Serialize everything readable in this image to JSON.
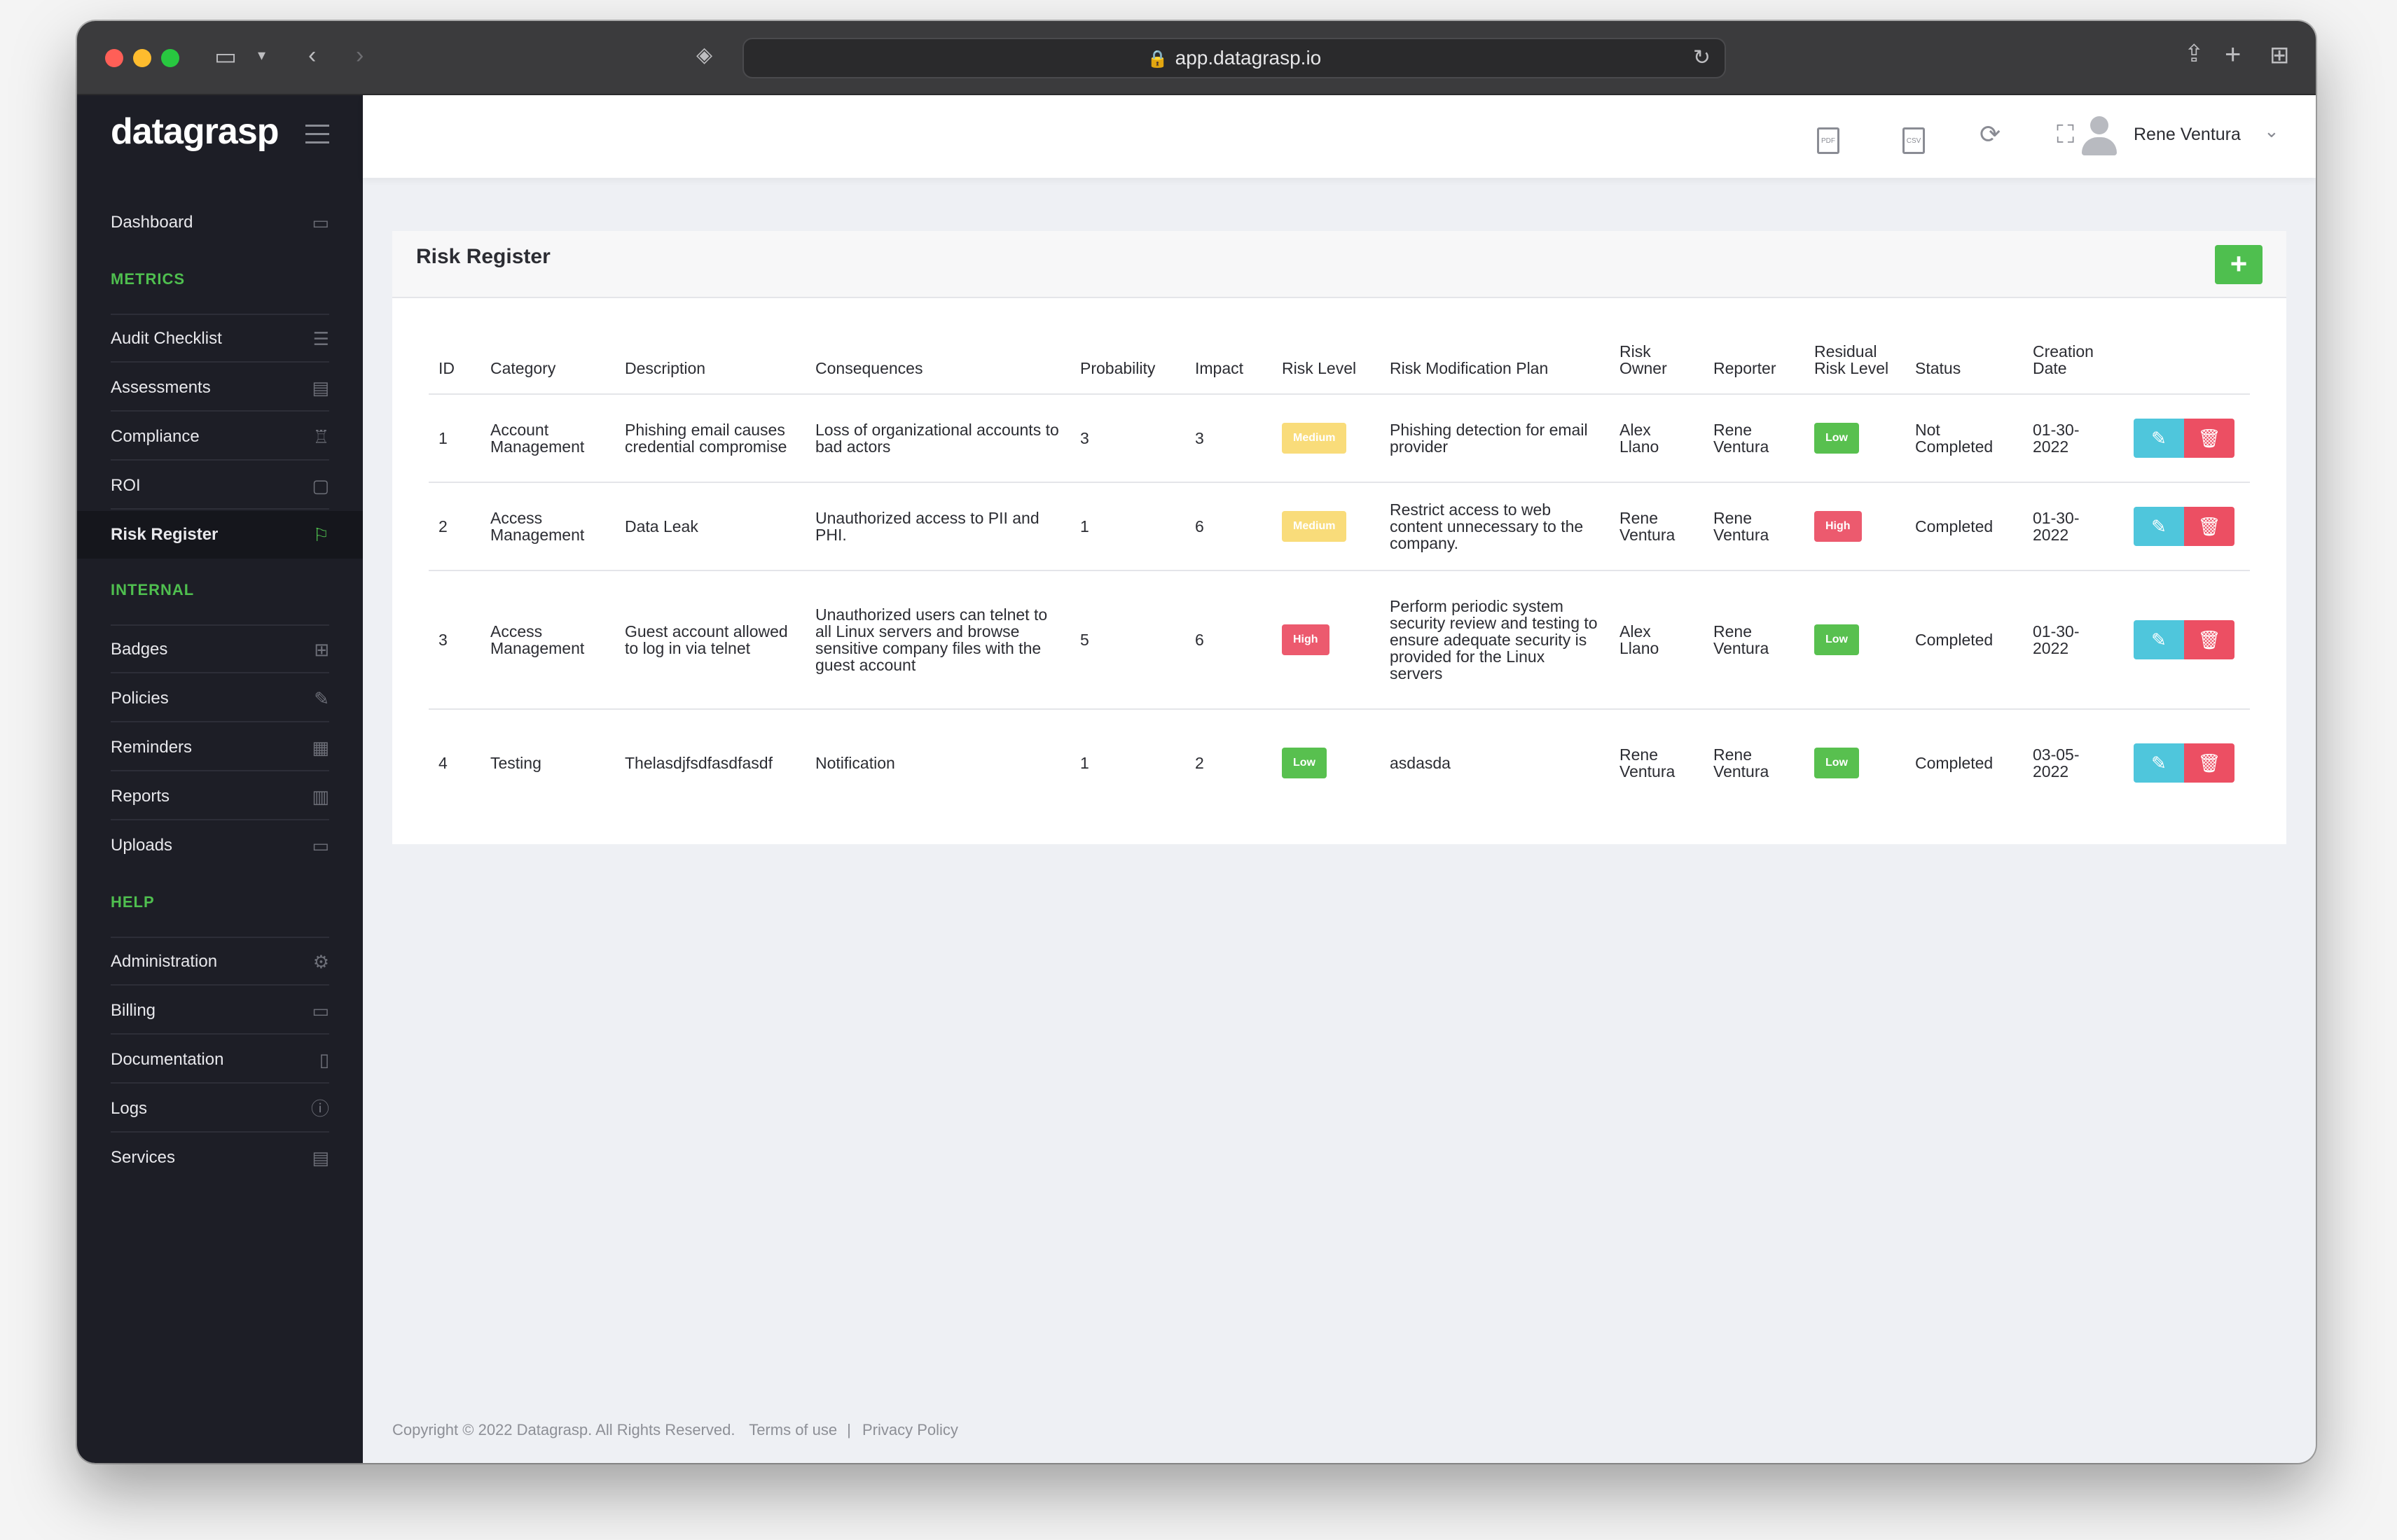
{
  "browser": {
    "url": "app.datagrasp.io"
  },
  "sidebar": {
    "logo": "datagrasp",
    "dashboard": "Dashboard",
    "sections": {
      "metrics": "METRICS",
      "internal": "INTERNAL",
      "help": "HELP"
    },
    "metrics_items": [
      {
        "label": "Audit Checklist",
        "icon": "list-icon"
      },
      {
        "label": "Assessments",
        "icon": "book-icon"
      },
      {
        "label": "Compliance",
        "icon": "trophy-icon"
      },
      {
        "label": "ROI",
        "icon": "wallet-icon"
      },
      {
        "label": "Risk Register",
        "icon": "flag-icon"
      }
    ],
    "internal_items": [
      {
        "label": "Badges",
        "icon": "grid-icon"
      },
      {
        "label": "Policies",
        "icon": "edit-icon"
      },
      {
        "label": "Reminders",
        "icon": "calendar-icon"
      },
      {
        "label": "Reports",
        "icon": "bar-chart-icon"
      },
      {
        "label": "Uploads",
        "icon": "folder-icon"
      }
    ],
    "help_items": [
      {
        "label": "Administration",
        "icon": "gear-icon"
      },
      {
        "label": "Billing",
        "icon": "credit-card-icon"
      },
      {
        "label": "Documentation",
        "icon": "file-icon"
      },
      {
        "label": "Logs",
        "icon": "info-icon"
      },
      {
        "label": "Services",
        "icon": "chat-icon"
      }
    ]
  },
  "topbar": {
    "pdf_icon_label": "PDF",
    "csv_icon_label": "CSV",
    "username": "Rene Ventura"
  },
  "card": {
    "title": "Risk Register",
    "add_label": "+"
  },
  "table": {
    "columns": [
      "ID",
      "Category",
      "Description",
      "Consequences",
      "Probability",
      "Impact",
      "Risk Level",
      "Risk Modification Plan",
      "Risk Owner",
      "Reporter",
      "Residual Risk Level",
      "Status",
      "Creation Date"
    ],
    "rows": [
      {
        "id": "1",
        "category": "Account Management",
        "description": "Phishing email causes credential compromise",
        "consequences": "Loss of organizational accounts to bad actors",
        "probability": "3",
        "impact": "3",
        "risk_level": "Medium",
        "plan": "Phishing detection for email provider",
        "owner": "Alex Llano",
        "reporter": "Rene Ventura",
        "residual": "Low",
        "status": "Not Completed",
        "date": "01-30-2022"
      },
      {
        "id": "2",
        "category": "Access Management",
        "description": "Data Leak",
        "consequences": "Unauthorized access to PII and PHI.",
        "probability": "1",
        "impact": "6",
        "risk_level": "Medium",
        "plan": "Restrict access to web content unnecessary to the company.",
        "owner": "Rene Ventura",
        "reporter": "Rene Ventura",
        "residual": "High",
        "status": "Completed",
        "date": "01-30-2022"
      },
      {
        "id": "3",
        "category": "Access Management",
        "description": "Guest account allowed to log in via telnet",
        "consequences": "Unauthorized users can telnet to all Linux servers and browse sensitive company files with the guest account",
        "probability": "5",
        "impact": "6",
        "risk_level": "High",
        "plan": "Perform periodic system security review and testing to ensure adequate security is provided for the Linux servers",
        "owner": "Alex Llano",
        "reporter": "Rene Ventura",
        "residual": "Low",
        "status": "Completed",
        "date": "01-30-2022"
      },
      {
        "id": "4",
        "category": "Testing",
        "description": "Thelasdjfsdfasdfasdf",
        "consequences": "Notification",
        "probability": "1",
        "impact": "2",
        "risk_level": "Low",
        "plan": "asdasda",
        "owner": "Rene Ventura",
        "reporter": "Rene Ventura",
        "residual": "Low",
        "status": "Completed",
        "date": "03-05-2022"
      }
    ]
  },
  "footer": {
    "copyright": "Copyright © 2022 Datagrasp. All Rights Reserved.",
    "terms": "Terms of use",
    "privacy": "Privacy Policy"
  },
  "colors": {
    "accent_green": "#4fbf4f",
    "sidebar_bg": "#1d1e26",
    "medium": "#f9dc7a",
    "high": "#ec5a6e",
    "low": "#58c04f",
    "edit": "#4fc6dc",
    "delete": "#ec4f63"
  }
}
